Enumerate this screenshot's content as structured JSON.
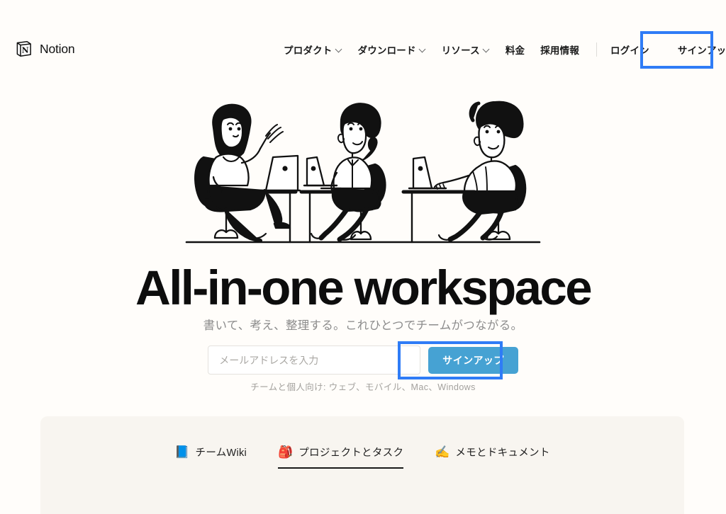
{
  "header": {
    "brand_name": "Notion",
    "brand_logo_icon": "notion-cube-icon",
    "nav": [
      {
        "label": "プロダクト",
        "has_dropdown": true
      },
      {
        "label": "ダウンロード",
        "has_dropdown": true
      },
      {
        "label": "リソース",
        "has_dropdown": true
      },
      {
        "label": "料金",
        "has_dropdown": false
      },
      {
        "label": "採用情報",
        "has_dropdown": false
      }
    ],
    "login_label": "ログイン",
    "signup_label": "サインアップ"
  },
  "hero": {
    "illustration_name": "three-people-at-desks-with-laptops-illustration",
    "headline": "All-in-one workspace",
    "subheadline": "書いて、考え、整理する。これひとつでチームがつながる。",
    "email_placeholder": "メールアドレスを入力",
    "email_value": "",
    "cta_label": "サインアップ",
    "platforms_note": "チームと個人向け: ウェブ、モバイル、Mac、Windows"
  },
  "features": {
    "tabs": [
      {
        "emoji": "📘",
        "icon_name": "blue-book-icon",
        "label": "チームWiki",
        "active": false
      },
      {
        "emoji": "🎒",
        "icon_name": "backpack-icon",
        "label": "プロジェクトとタスク",
        "active": true
      },
      {
        "emoji": "✍️",
        "icon_name": "writing-hand-icon",
        "label": "メモとドキュメント",
        "active": false
      }
    ]
  },
  "annotations": {
    "highlight_color": "#2F7CF6",
    "boxes": [
      {
        "target": "nav-signup-button"
      },
      {
        "target": "hero-signup-button"
      }
    ]
  },
  "colors": {
    "page_background": "#FFFDFA",
    "card_background": "#F8F5F0",
    "cta_blue": "#46A2D3",
    "annotation_blue": "#2F7CF6",
    "text_primary": "#141414",
    "text_muted": "#8C8C8C"
  }
}
